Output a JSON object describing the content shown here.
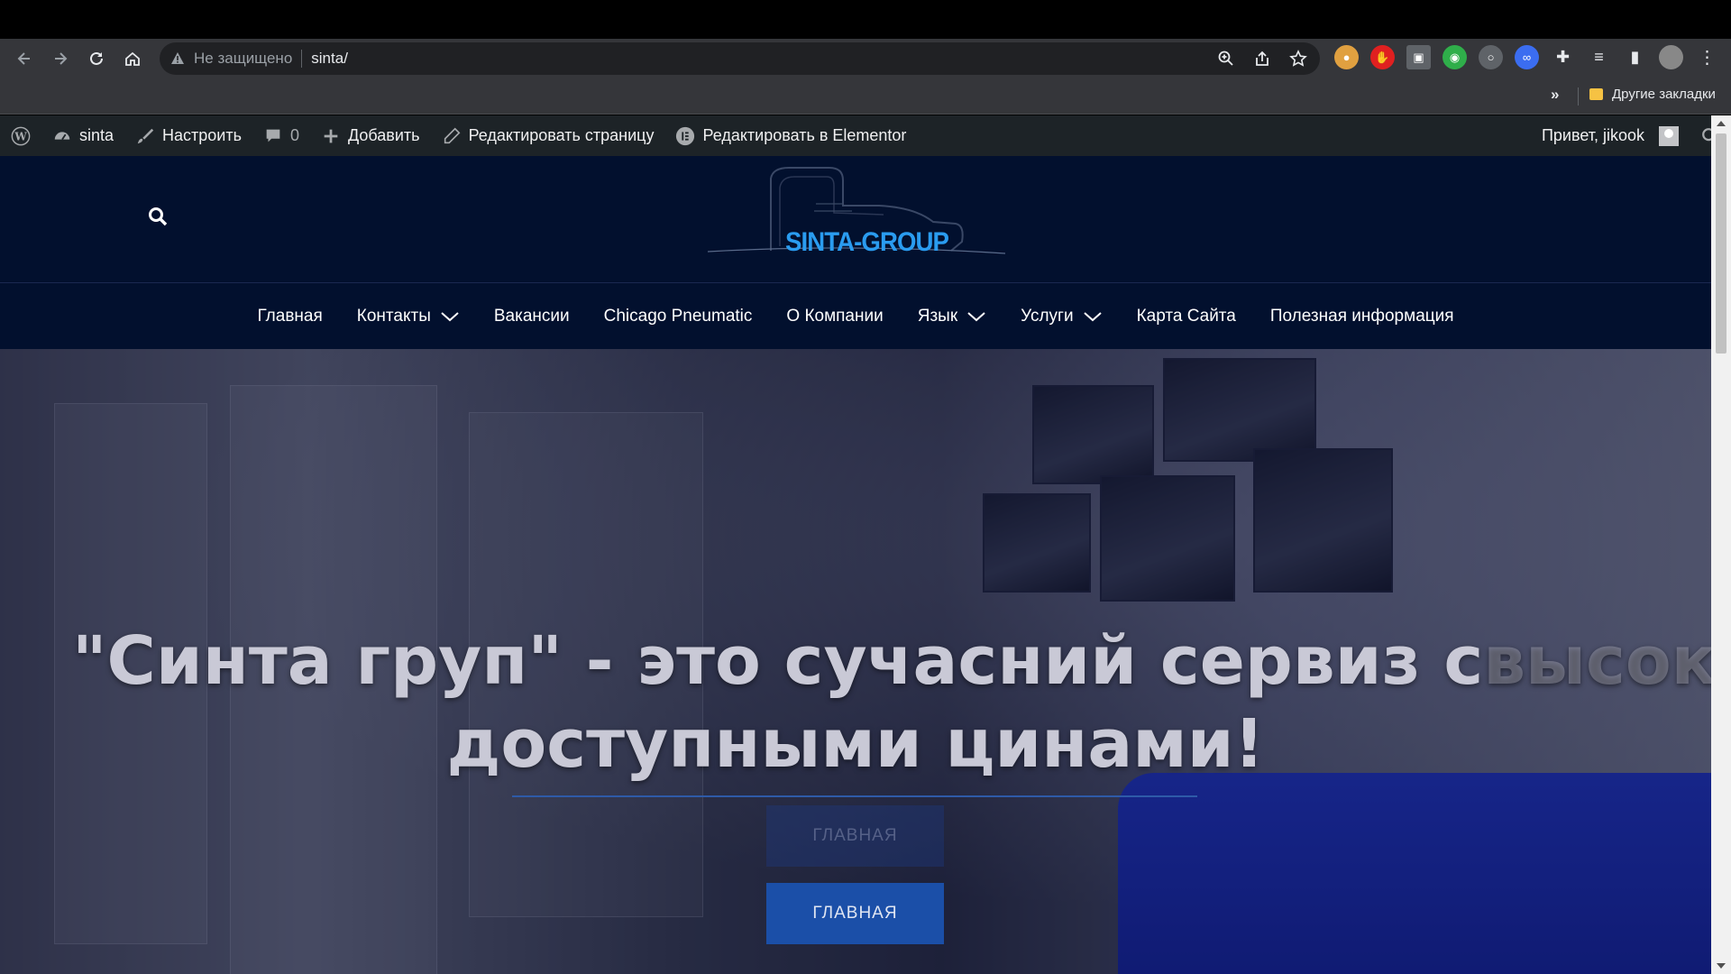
{
  "browser": {
    "insecure_label": "Не защищено",
    "url": "sinta/",
    "bookmarks_more": "»",
    "bookmarks_folder": "Другие закладки"
  },
  "adminbar": {
    "site_name": "sinta",
    "customize": "Настроить",
    "comments_count": "0",
    "add_new": "Добавить",
    "edit_page": "Редактировать страницу",
    "edit_elementor": "Редактировать в Elementor",
    "greeting": "Привет, jikook"
  },
  "header": {
    "logo_text": "SINTA-GROUP"
  },
  "menu": {
    "items": [
      {
        "label": "Главная"
      },
      {
        "label": "Контакты"
      },
      {
        "label": "Вакансии"
      },
      {
        "label": "Chicago Pneumatic"
      },
      {
        "label": "О Компании"
      },
      {
        "label": "Язык"
      },
      {
        "label": "Услуги"
      },
      {
        "label": "Карта Сайта"
      },
      {
        "label": "Полезная информация"
      }
    ]
  },
  "hero": {
    "title_line1": "\"Синта груп\" - это сучасний сервиз с",
    "title_line1_fade": "высоко",
    "title_line2": "доступными цинами!",
    "ghost_button": "ГЛАВНАЯ",
    "button": "ГЛАВНАЯ"
  },
  "colors": {
    "admin_bar": "#1d2327",
    "header_bg": "#02102e",
    "button": "#1b4fa8",
    "logo": "#2a9cf0"
  }
}
